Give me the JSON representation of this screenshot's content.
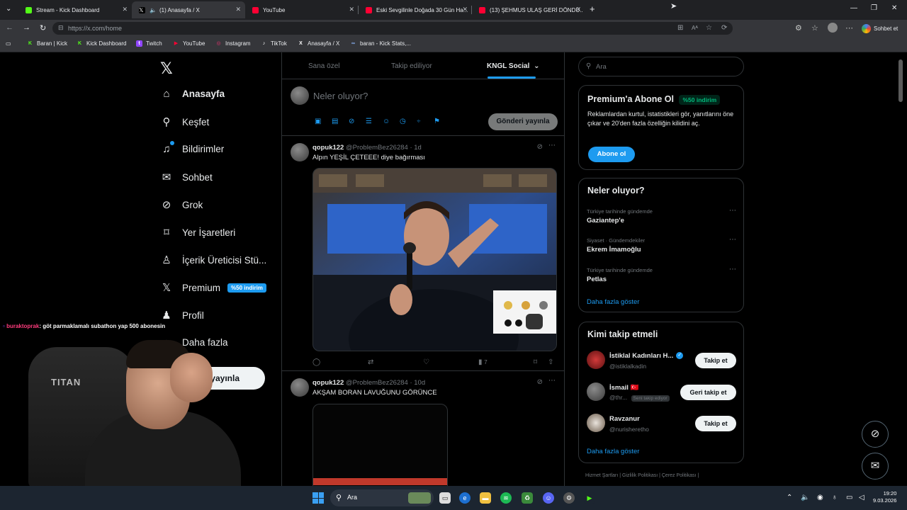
{
  "browser": {
    "tabs": [
      {
        "title": "Stream - Kick Dashboard",
        "color": "#53fc18"
      },
      {
        "title": "(1) Anasayfa / X",
        "color": "#ffffff"
      },
      {
        "title": "YouTube",
        "color": "#ff0033"
      },
      {
        "title": "Eski Sevgilinle Doğada 30 Gün Ha...",
        "color": "#ff0033"
      },
      {
        "title": "(13) ŞEHMUS ULAŞ GERİ DÖNDÜ...",
        "color": "#ff0033"
      }
    ],
    "new_tab_label": "+",
    "url": "https://x.com/home",
    "sohbet_label": "Sohbet et",
    "bookmarks": [
      {
        "label": "Baran | Kick",
        "icon": "K",
        "color": "#53fc18"
      },
      {
        "label": "Kick Dashboard",
        "icon": "K",
        "color": "#53fc18"
      },
      {
        "label": "Twitch",
        "icon": "t",
        "color": "#9146ff"
      },
      {
        "label": "YouTube",
        "icon": "▶",
        "color": "#ff0033"
      },
      {
        "label": "Instagram",
        "icon": "◎",
        "color": "#e1306c"
      },
      {
        "label": "TikTok",
        "icon": "♪",
        "color": "#000000"
      },
      {
        "label": "Anasayfa / X",
        "icon": "X",
        "color": "#000000"
      },
      {
        "label": "baran - Kick Stats,...",
        "icon": "∞",
        "color": "#8ab4f8"
      }
    ]
  },
  "nav": {
    "items": [
      {
        "label": "Anasayfa",
        "icon": "home-icon",
        "glyph": "⌂"
      },
      {
        "label": "Keşfet",
        "icon": "search-icon",
        "glyph": "⚲"
      },
      {
        "label": "Bildirimler",
        "icon": "bell-icon",
        "glyph": "🔔"
      },
      {
        "label": "Sohbet",
        "icon": "mail-icon",
        "glyph": "✉"
      },
      {
        "label": "Grok",
        "icon": "grok-icon",
        "glyph": "⊘"
      },
      {
        "label": "Yer İşaretleri",
        "icon": "bookmark-icon",
        "glyph": "⌑"
      },
      {
        "label": "İçerik Üreticisi Stü...",
        "icon": "creator-icon",
        "glyph": "♙"
      },
      {
        "label": "Premium",
        "icon": "x-premium-icon",
        "glyph": "𝕏"
      },
      {
        "label": "Profil",
        "icon": "profile-icon",
        "glyph": "♟"
      },
      {
        "label": "Daha fazla",
        "icon": "more-icon",
        "glyph": "◌"
      }
    ],
    "premium_badge": "%50 indirim",
    "post_button": "Gönderi yayınla",
    "post_button_visible": "ri yayınla"
  },
  "timeline": {
    "tabs": [
      "Sana özel",
      "Takip ediliyor",
      "KNGL Social"
    ],
    "composer_placeholder": "Neler oluyor?",
    "publish_button": "Gönderi yayınla",
    "tweets": [
      {
        "name": "qopuk122",
        "handle": "@ProblemBez26284",
        "time": "· 1d",
        "text": "Alpın YEŞİL ÇETEEE! diye bağırması",
        "views": "7"
      },
      {
        "name": "qopuk122",
        "handle": "@ProblemBez26284",
        "time": "· 10d",
        "text": "AKŞAM BORAN LAVUĞUNU GÖRÜNCE"
      }
    ]
  },
  "sidebar": {
    "search_placeholder": "Ara",
    "premium": {
      "title": "Premium'a Abone Ol",
      "badge": "%50 indirim",
      "body": "Reklamlardan kurtul, istatistikleri gör, yanıtlarını öne çıkar ve 20'den fazla özelliğin kilidini aç.",
      "button": "Abone ol"
    },
    "trends": {
      "title": "Neler oluyor?",
      "items": [
        {
          "meta": "Türkiye tarihinde gündemde",
          "name": "Gaziantep'e"
        },
        {
          "meta": "Siyaset · Gündemdekiler",
          "name": "Ekrem İmamoğlu"
        },
        {
          "meta": "Türkiye tarihinde gündemde",
          "name": "Petlas"
        }
      ],
      "more": "Daha fazla göster"
    },
    "who_to_follow": {
      "title": "Kimi takip etmeli",
      "items": [
        {
          "name": "İstiklal Kadınları H...",
          "handle": "@istiklalkadin",
          "button": "Takip et"
        },
        {
          "name": "İsmail 🇹🇷",
          "handle": "@thr...",
          "follows_you": "Seni takip ediyor",
          "button": "Geri takip et"
        },
        {
          "name": "Ravzanur",
          "handle": "@nurisheretho",
          "button": "Takip et"
        }
      ],
      "more": "Daha fazla göster"
    },
    "footer": "Hizmet Şartları  |  Gizlilik Politikası  |  Çerez Politikası  |"
  },
  "overlay": {
    "chat_user": "buraktoprak",
    "chat_text": ": göt parmaklamalı subathon yap 500 abonesin",
    "chair_brand": "TITAN"
  },
  "taskbar": {
    "search_label": "Ara",
    "time": "19:20",
    "date": "9.03.2026"
  }
}
